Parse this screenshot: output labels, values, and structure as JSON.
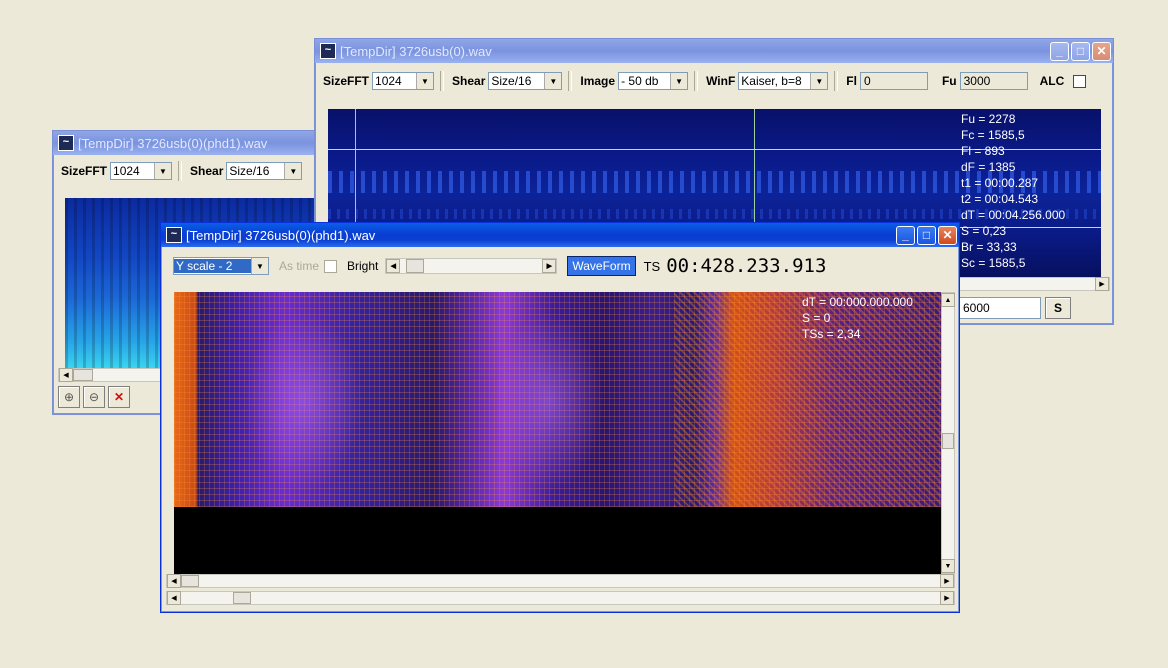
{
  "window_main": {
    "title": "[TempDir] 3726usb(0).wav",
    "title_icon": "spectrogram-app-icon",
    "toolbar": {
      "sizefft_label": "SizeFFT",
      "sizefft_value": "1024",
      "shear_label": "Shear",
      "shear_value": "Size/16",
      "image_label": "Image",
      "image_value": "- 50 db",
      "winf_label": "WinF",
      "winf_value": "Kaiser, b=8",
      "fl_label": "Fl",
      "fl_value": "0",
      "fu_label": "Fu",
      "fu_value": "3000",
      "alc_label": "ALC"
    },
    "readout": [
      "Fu = 2278",
      "Fc = 1585,5",
      "Fl = 893",
      "dF = 1385",
      "t1 = 00:00.287",
      "t2 = 00:04.543",
      "dT = 00:04.256.000",
      "S = 0,23",
      "Br = 33,33",
      "Sc = 1585,5"
    ],
    "bottom_field_value": "6000",
    "bottom_button_label": "S"
  },
  "window_phd_back": {
    "title": "[TempDir] 3726usb(0)(phd1).wav",
    "toolbar": {
      "sizefft_label": "SizeFFT",
      "sizefft_value": "1024",
      "shear_label": "Shear",
      "shear_value": "Size/16"
    }
  },
  "window_phd_front": {
    "title": "[TempDir] 3726usb(0)(phd1).wav",
    "toolbar": {
      "yscale_value": "Y scale - 2",
      "as_time_label": "As time",
      "bright_label": "Bright",
      "waveform_label": "WaveForm",
      "ts_label": "TS",
      "ts_value": "00:428.233.913"
    },
    "readout": [
      "dT = 00:000.000.000",
      "S = 0",
      "TSs = 2,34"
    ]
  },
  "colors": {
    "titlebar_active": "#0a3ed4",
    "titlebar_inactive": "#7b93de",
    "desktop": "#ece9d8",
    "spectrogram_blue": "#0a1c8a",
    "spectrogram_purple": "#6a1cc8",
    "spectrogram_orange": "#e86a1a"
  }
}
